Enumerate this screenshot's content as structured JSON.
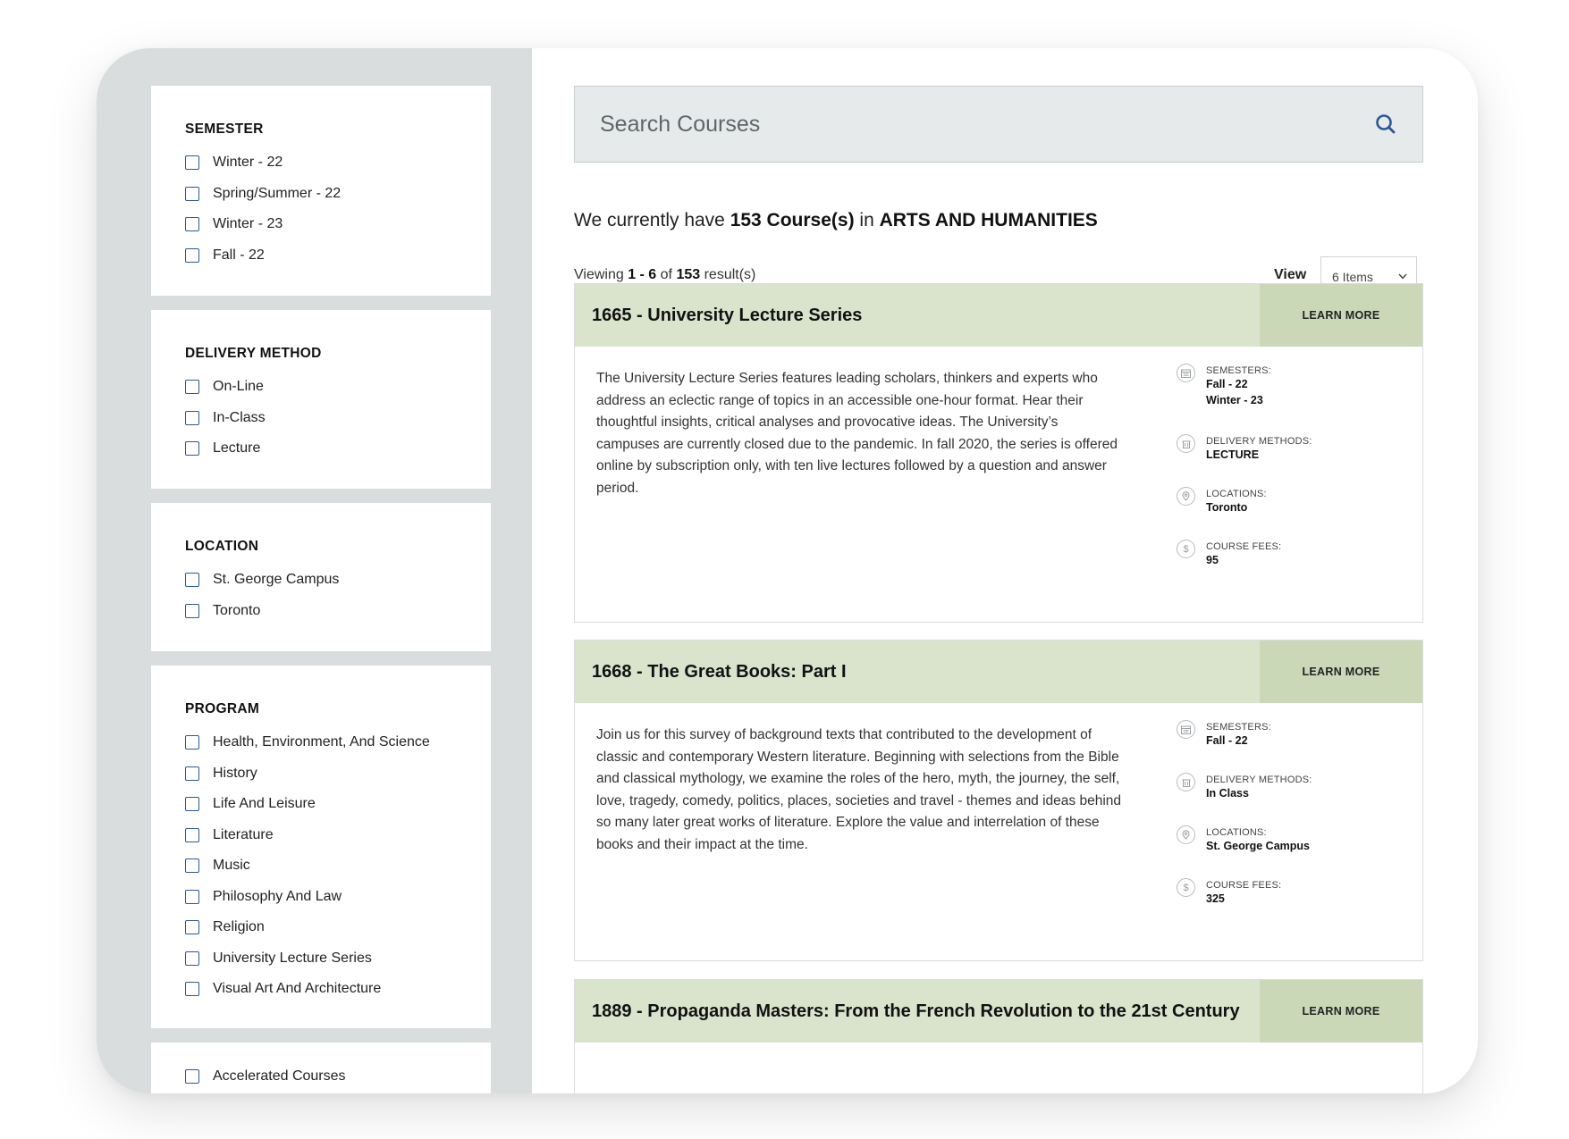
{
  "filters": {
    "semester": {
      "title": "SEMESTER",
      "options": [
        "Winter - 22",
        "Spring/Summer - 22",
        "Winter - 23",
        "Fall - 22"
      ]
    },
    "delivery": {
      "title": "DELIVERY METHOD",
      "options": [
        "On-Line",
        "In-Class",
        "Lecture"
      ]
    },
    "location": {
      "title": "LOCATION",
      "options": [
        "St. George Campus",
        "Toronto"
      ]
    },
    "program": {
      "title": "PROGRAM",
      "options": [
        "Health, Environment, And Science",
        "History",
        "Life And Leisure",
        "Literature",
        "Music",
        "Philosophy And Law",
        "Religion",
        "University Lecture Series",
        "Visual Art And Architecture"
      ]
    },
    "extra": {
      "options": [
        "Accelerated Courses"
      ]
    }
  },
  "search": {
    "placeholder": "Search Courses"
  },
  "summary": {
    "prefix": "We currently have ",
    "count": "153 Course(s)",
    "middle": " in ",
    "category": "ARTS AND HUMANITIES"
  },
  "viewing": {
    "prefix": "Viewing ",
    "range": "1 - 6",
    "of": " of ",
    "total": "153",
    "suffix": " result(s)"
  },
  "view": {
    "label": "View",
    "selected": "6 Items"
  },
  "learn_more_label": "LEARN MORE",
  "meta_labels": {
    "semesters": "SEMESTERS:",
    "delivery": "DELIVERY METHODS:",
    "locations": "LOCATIONS:",
    "fees": "COURSE FEES:"
  },
  "courses": [
    {
      "title": "1665 - University Lecture Series",
      "description": "The University Lecture Series features leading scholars, thinkers and experts who address an eclectic range of topics in an accessible one-hour format. Hear their thoughtful insights, critical analyses and provocative ideas.  The University’s campuses are currently closed due to the pandemic. In fall 2020, the series is offered online by subscription only, with ten live lectures followed by a question and answer period.",
      "semesters": [
        "Fall - 22",
        "Winter - 23"
      ],
      "delivery": "LECTURE",
      "location": "Toronto",
      "fee": "95"
    },
    {
      "title": "1668 - The Great Books: Part I",
      "description": "Join us for this survey of background texts that contributed to the development of classic and contemporary Western literature. Beginning with selections from the Bible and classical mythology, we examine the roles of the hero, myth, the journey, the self, love, tragedy, comedy, politics, places, societies and travel - themes and ideas behind so many later great works of literature. Explore the value and interrelation of these books and their impact at the time.",
      "semesters": [
        "Fall - 22"
      ],
      "delivery": "In Class",
      "location": "St. George Campus",
      "fee": "325"
    },
    {
      "title": "1889 - Propaganda Masters: From the French Revolution to the 21st Century"
    }
  ]
}
